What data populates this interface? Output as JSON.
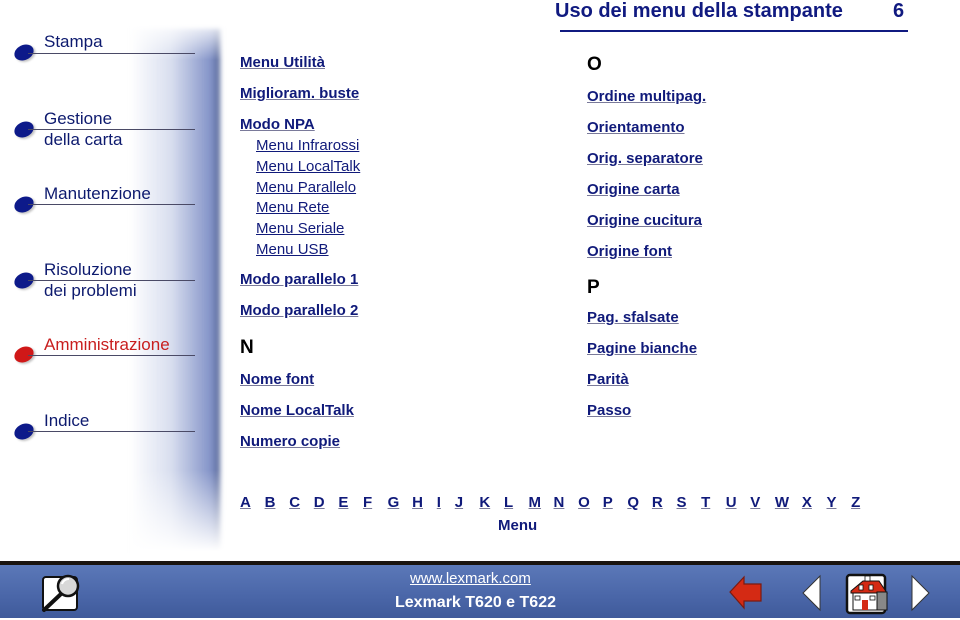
{
  "header": {
    "title": "Uso dei menu della stampante",
    "page_number": "6"
  },
  "sidebar": {
    "items": [
      {
        "label": "Stampa",
        "active": false
      },
      {
        "label": "Gestione\ndella carta",
        "active": false
      },
      {
        "label": "Manutenzione",
        "active": false
      },
      {
        "label": "Risoluzione\ndei problemi",
        "active": false
      },
      {
        "label": "Amministrazione",
        "active": true
      },
      {
        "label": "Indice",
        "active": false
      }
    ]
  },
  "index": {
    "col1": {
      "entries": [
        {
          "label": "Menu Utilità"
        },
        {
          "label": "Miglioram. buste"
        },
        {
          "label": "Modo NPA",
          "children": [
            "Menu Infrarossi",
            "Menu LocalTalk",
            "Menu Parallelo",
            "Menu Rete",
            "Menu Seriale",
            "Menu USB"
          ]
        },
        {
          "label": "Modo parallelo 1"
        },
        {
          "label": "Modo parallelo 2"
        }
      ],
      "section_n": {
        "letter": "N",
        "entries": [
          "Nome font",
          "Nome LocalTalk",
          "Numero copie"
        ]
      }
    },
    "col2": {
      "section_o": {
        "letter": "O",
        "entries": [
          "Ordine multipag.",
          "Orientamento",
          "Orig. separatore",
          "Origine carta",
          "Origine cucitura",
          "Origine font"
        ]
      },
      "section_p": {
        "letter": "P",
        "entries": [
          "Pag. sfalsate",
          "Pagine bianche",
          "Parità",
          "Passo"
        ]
      }
    }
  },
  "alphabet": {
    "letters": [
      "A",
      "B",
      "C",
      "D",
      "E",
      "F",
      "G",
      "H",
      "I",
      "J",
      "K",
      "L",
      "M",
      "N",
      "O",
      "P",
      "Q",
      "R",
      "S",
      "T",
      "U",
      "V",
      "W",
      "X",
      "Y",
      "Z"
    ],
    "menu_label": "Menu"
  },
  "footer": {
    "url": "www.lexmark.com",
    "model": "Lexmark T620 e T622",
    "icons": [
      "search-icon",
      "back-arrow-icon",
      "previous-page-icon",
      "home-icon",
      "next-page-icon"
    ]
  },
  "colors": {
    "link": "#101a7a",
    "accent_active": "#c81e1e",
    "footer_bg": "#4a66a8"
  }
}
